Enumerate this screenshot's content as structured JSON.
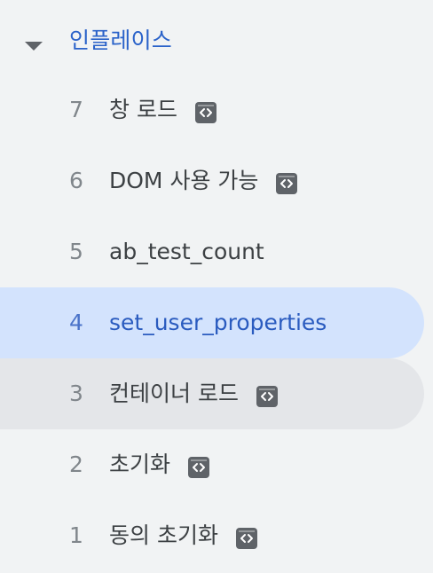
{
  "group": {
    "title": "인플레이스",
    "expanded": true,
    "caret_icon": "caret-down-icon"
  },
  "events": [
    {
      "number": "7",
      "label": "창 로드",
      "has_code_icon": true,
      "state": "normal"
    },
    {
      "number": "6",
      "label": "DOM 사용 가능",
      "has_code_icon": true,
      "state": "normal"
    },
    {
      "number": "5",
      "label": "ab_test_count",
      "has_code_icon": false,
      "state": "normal"
    },
    {
      "number": "4",
      "label": "set_user_properties",
      "has_code_icon": false,
      "state": "selected"
    },
    {
      "number": "3",
      "label": "컨테이너 로드",
      "has_code_icon": true,
      "state": "hovered"
    },
    {
      "number": "2",
      "label": "초기화",
      "has_code_icon": true,
      "state": "normal"
    },
    {
      "number": "1",
      "label": "동의 초기화",
      "has_code_icon": true,
      "state": "normal"
    }
  ],
  "colors": {
    "background": "#f1f3f4",
    "accent": "#2a62c9",
    "selected_bg": "#d3e3fd",
    "hover_bg": "#e4e6e9",
    "icon": "#5f6368"
  }
}
